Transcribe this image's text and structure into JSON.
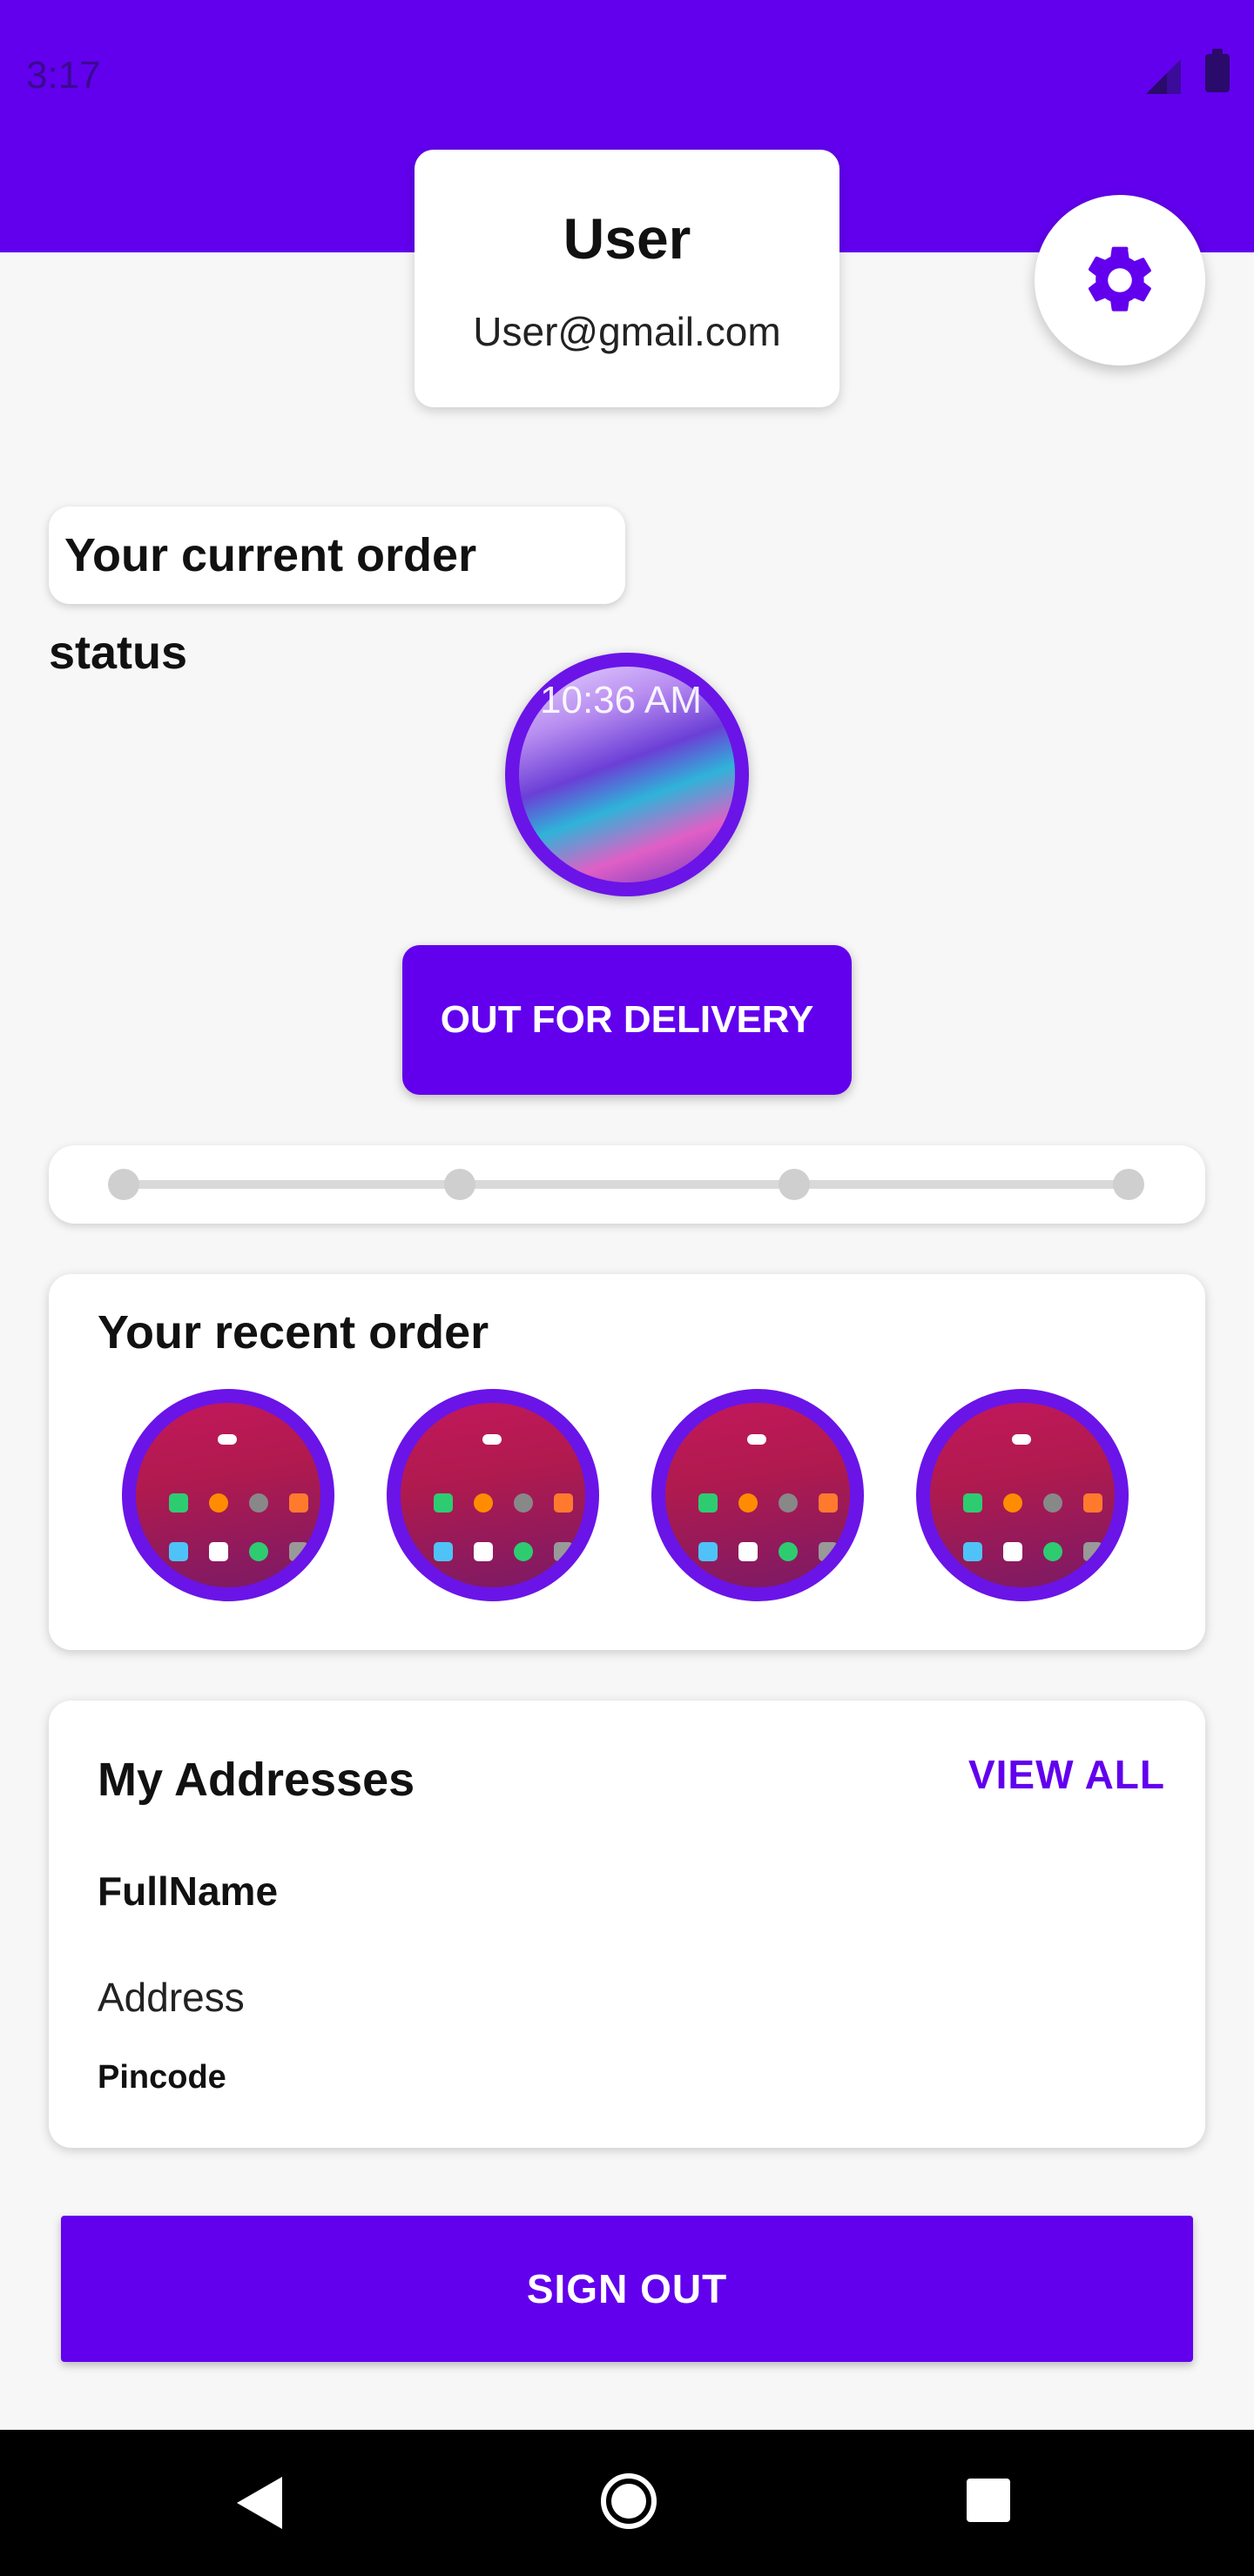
{
  "status_bar": {
    "time": "3:17",
    "signal_icon": "signal-icon",
    "battery_icon": "battery-icon"
  },
  "profile": {
    "name": "User",
    "email": "User@gmail.com"
  },
  "settings": {
    "icon": "gear-icon"
  },
  "order_status": {
    "label": "Your current order status",
    "image_clock_text": "10:36 AM",
    "status_button": "OUT FOR DELIVERY",
    "progress": {
      "steps": 4,
      "completed": 0
    }
  },
  "recent_orders": {
    "title": "Your recent order",
    "items": [
      "order-thumb-1",
      "order-thumb-2",
      "order-thumb-3",
      "order-thumb-4"
    ]
  },
  "addresses": {
    "title": "My Addresses",
    "view_all": "VIEW ALL",
    "full_name": "FullName",
    "address": "Address",
    "pincode": "Pincode"
  },
  "actions": {
    "sign_out": "SIGN OUT"
  },
  "nav": {
    "back_icon": "back-icon",
    "home_icon": "home-icon",
    "recents_icon": "recents-icon"
  },
  "colors": {
    "primary": "#6200ee",
    "background": "#f7f7f7",
    "card": "#ffffff"
  }
}
